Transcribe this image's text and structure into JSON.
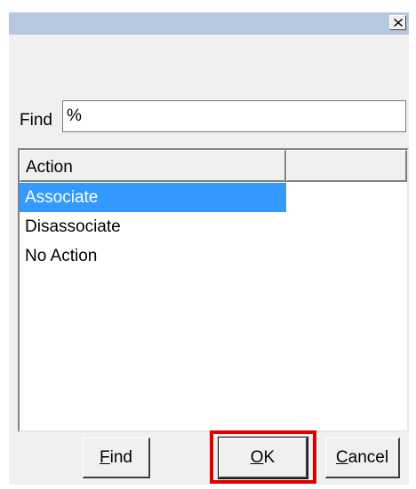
{
  "dialog": {
    "title": "",
    "close_icon": "close-icon"
  },
  "find": {
    "label": "Find",
    "value": "%"
  },
  "list": {
    "columns": [
      "Action",
      ""
    ],
    "items": [
      {
        "label": "Associate",
        "selected": true
      },
      {
        "label": "Disassociate",
        "selected": false
      },
      {
        "label": "No Action",
        "selected": false
      }
    ]
  },
  "buttons": {
    "find": {
      "mnemonic": "F",
      "rest": "ind"
    },
    "ok": {
      "mnemonic": "O",
      "rest": "K"
    },
    "cancel": {
      "mnemonic": "C",
      "rest": "ancel"
    }
  },
  "colors": {
    "titlebar": "#b6c8e0",
    "selection": "#3399ff",
    "highlight": "#e00000"
  }
}
